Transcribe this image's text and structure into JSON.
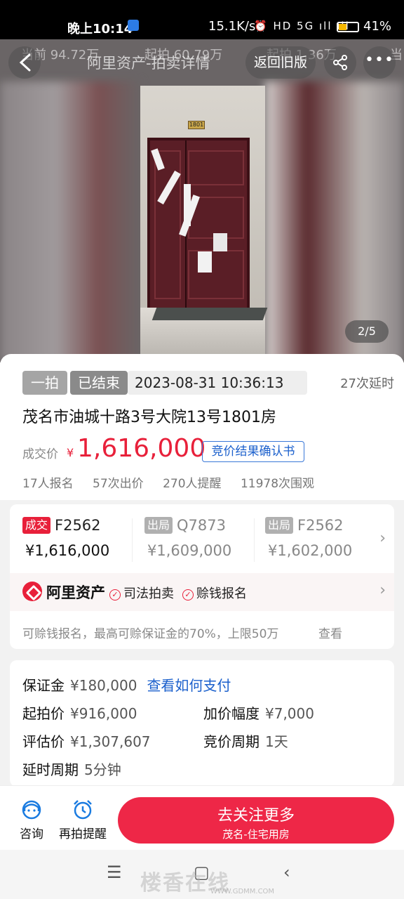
{
  "status_bar": {
    "time": "晚上10:14",
    "net_speed": "15.1K/s",
    "icons": "⏰ HD 5G ıll ıll",
    "battery": "41%"
  },
  "hero": {
    "ghost_row": [
      "当前 94.72万",
      "起拍 60.79万",
      "起拍 1.36万",
      "当"
    ],
    "door_plate": "1801",
    "counter": "2/5"
  },
  "nav": {
    "title": "阿里资产-拍卖详情",
    "old_version": "返回旧版",
    "more": "•••"
  },
  "info": {
    "tag_yipai": "一拍",
    "tag_status": "已结束",
    "end_time": "2023-08-31 10:36:13",
    "delays": "27次延时",
    "address": "茂名市油城十路3号大院13号1801房",
    "deal_label": "成交价",
    "currency": "¥",
    "deal_price": "1,616,000",
    "confirm_link": "竞价结果确认书",
    "stats": [
      "17人报名",
      "57次出价",
      "270人提醒",
      "11978次围观"
    ]
  },
  "lots": {
    "items": [
      {
        "badge": "成交",
        "code": "F2562",
        "price": "¥1,616,000"
      },
      {
        "badge": "出局",
        "code": "Q7873",
        "price": "¥1,609,000"
      },
      {
        "badge": "出局",
        "code": "F2562",
        "price": "¥1,602,000"
      }
    ],
    "brand": "阿里资产",
    "tag_judicial": "司法拍卖",
    "tag_loan": "赊钱报名",
    "note": "可赊钱报名，最高可赊保证金的70%，上限50万",
    "note_link": "查看"
  },
  "params": {
    "deposit_label": "保证金",
    "deposit_value": "¥180,000",
    "deposit_link": "查看如何支付",
    "start_label": "起拍价",
    "start_value": "¥916,000",
    "step_label": "加价幅度",
    "step_value": "¥7,000",
    "assess_label": "评估价",
    "assess_value": "¥1,307,607",
    "cycle_label": "竞价周期",
    "cycle_value": "1天",
    "delay_label": "延时周期",
    "delay_value": "5分钟"
  },
  "bottom": {
    "consult": "咨询",
    "remind": "再拍提醒",
    "follow_title": "去关注更多",
    "follow_sub": "茂名-住宅用房"
  },
  "sysnav": {
    "menu": "☰",
    "home": "▢",
    "back": "‹"
  },
  "watermark": {
    "main": "楼香在线",
    "url": "WWW.GDMM.COM"
  },
  "colors": {
    "accent_red": "#e8203a",
    "link_blue": "#1a5fcc",
    "button_red": "#ee2747"
  }
}
